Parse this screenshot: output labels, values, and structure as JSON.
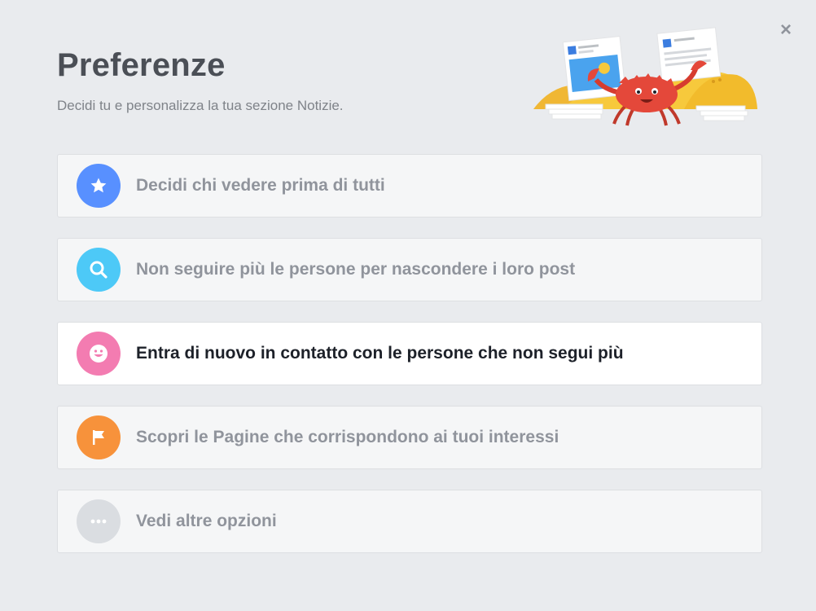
{
  "dialog": {
    "title": "Preferenze",
    "subtitle": "Decidi tu e personalizza la tua sezione Notizie.",
    "close_label": "×"
  },
  "options": [
    {
      "label": "Decidi chi vedere prima di tutti",
      "icon": "star-icon",
      "color": "#5890ff"
    },
    {
      "label": "Non seguire più le persone per nascondere i loro post",
      "icon": "search-icon",
      "color": "#4dc9f7"
    },
    {
      "label": "Entra di nuovo in contatto con le persone che non segui più",
      "icon": "smiley-icon",
      "color": "#f37cb1"
    },
    {
      "label": "Scopri le Pagine che corrispondono ai tuoi interessi",
      "icon": "flag-icon",
      "color": "#f7923b"
    },
    {
      "label": "Vedi altre opzioni",
      "icon": "more-icon",
      "color": "#dadde1"
    }
  ],
  "colors": {
    "background": "#e9ebee",
    "title": "#4b4f56",
    "option_text": "#90949c",
    "option_text_active": "#1d2129"
  }
}
